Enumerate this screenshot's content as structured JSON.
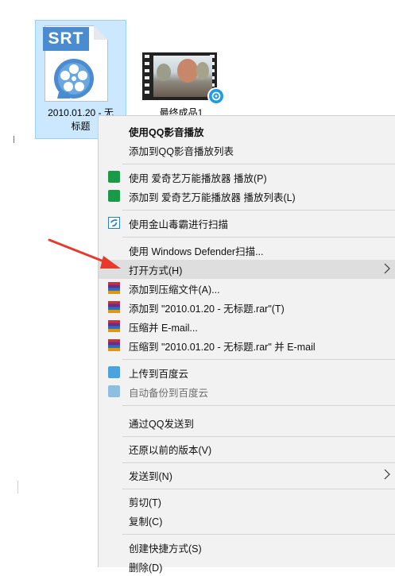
{
  "desktop": {
    "files": [
      {
        "tag": "SRT",
        "name_line1": "2010.01.20 - 无",
        "name_line2": "标题"
      },
      {
        "name": "最终成品1"
      }
    ]
  },
  "menu": {
    "items": [
      {
        "label": "使用QQ影音播放"
      },
      {
        "label": "添加到QQ影音播放列表"
      },
      {
        "label": "使用 爱奇艺万能播放器 播放(P)"
      },
      {
        "label": "添加到 爱奇艺万能播放器 播放列表(L)"
      },
      {
        "label": "使用金山毒霸进行扫描"
      },
      {
        "label": "使用 Windows Defender扫描..."
      },
      {
        "label": "打开方式(H)"
      },
      {
        "label": "添加到压缩文件(A)..."
      },
      {
        "label": "添加到 \"2010.01.20 - 无标题.rar\"(T)"
      },
      {
        "label": "压缩并 E-mail..."
      },
      {
        "label": "压缩到 \"2010.01.20 - 无标题.rar\" 并 E-mail"
      },
      {
        "label": "上传到百度云"
      },
      {
        "label": "自动备份到百度云"
      },
      {
        "label": "通过QQ发送到"
      },
      {
        "label": "还原以前的版本(V)"
      },
      {
        "label": "发送到(N)"
      },
      {
        "label": "剪切(T)"
      },
      {
        "label": "复制(C)"
      },
      {
        "label": "创建快捷方式(S)"
      },
      {
        "label": "删除(D)"
      }
    ]
  },
  "colors": {
    "menu_bg": "#f2f2f2",
    "hover_bg": "#dedede",
    "selection_bg": "#cce8ff",
    "arrow_red": "#e8392f"
  }
}
